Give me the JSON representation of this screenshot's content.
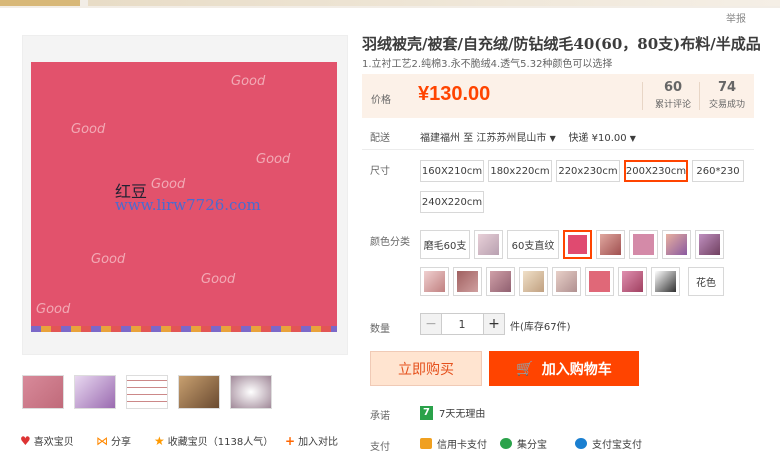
{
  "header": {
    "report_link": "举报"
  },
  "product": {
    "title": "羽绒被壳/被套/自充绒/防钻绒毛40(60，80支)布料/半成品",
    "subtitle": "1.立衬工艺2.纯棉3.永不脆绒4.透气5.32种颜色可以选择",
    "image_watermark_cn": "红豆",
    "image_watermark_url": "www.lirw7726.com"
  },
  "price": {
    "label": "价格",
    "value": "¥130.00",
    "reviews_count": "60",
    "reviews_label": "累计评论",
    "sales_count": "74",
    "sales_label": "交易成功"
  },
  "shipping": {
    "label": "配送",
    "from": "福建福州",
    "to_word": "至",
    "to": "江苏苏州昆山市",
    "method": "快递 ¥10.00"
  },
  "size": {
    "label": "尺寸",
    "options": [
      "160X210cm",
      "180x220cm",
      "220x230cm",
      "200X230cm",
      "260*230",
      "240X220cm"
    ],
    "selected": "200X230cm"
  },
  "color": {
    "label": "颜色分类",
    "text_options": [
      "磨毛60支",
      "60支直纹",
      "花色"
    ],
    "swatches": [
      {
        "name": "swatch-2",
        "color": "#d9b3b8"
      },
      {
        "name": "swatch-4",
        "color": "#e04a70"
      },
      {
        "name": "swatch-5",
        "color": "#c98a8a"
      },
      {
        "name": "swatch-6",
        "color": "#d48aa8"
      },
      {
        "name": "swatch-7",
        "color": "#c79a7a"
      },
      {
        "name": "swatch-8",
        "color": "#b47aa0"
      },
      {
        "name": "swatch-9",
        "color": "#d8a0a0"
      },
      {
        "name": "swatch-10",
        "color": "#a06060"
      },
      {
        "name": "swatch-11",
        "color": "#b08080"
      },
      {
        "name": "swatch-12",
        "color": "#e0c8b0"
      },
      {
        "name": "swatch-13",
        "color": "#c8b0a8"
      },
      {
        "name": "swatch-14",
        "color": "#e07080"
      },
      {
        "name": "swatch-15",
        "color": "#c04a70"
      },
      {
        "name": "swatch-16",
        "color": "#403030"
      }
    ]
  },
  "quantity": {
    "label": "数量",
    "value": "1",
    "minus": "−",
    "plus": "+",
    "stock": "件(库存67件)"
  },
  "buttons": {
    "buy_now": "立即购买",
    "add_to_cart": "加入购物车"
  },
  "promise": {
    "label": "承诺",
    "badge": "7",
    "text": "7天无理由"
  },
  "payment": {
    "label": "支付",
    "methods": [
      "信用卡支付",
      "集分宝",
      "支付宝支付"
    ]
  },
  "actions": {
    "favorite": "喜欢宝贝",
    "share": "分享",
    "collect": "收藏宝贝（1138人气）",
    "compare": "加入对比"
  },
  "colors": {
    "accent": "#ff4400",
    "price": "#ff4400",
    "fabric": "#e2526c"
  }
}
